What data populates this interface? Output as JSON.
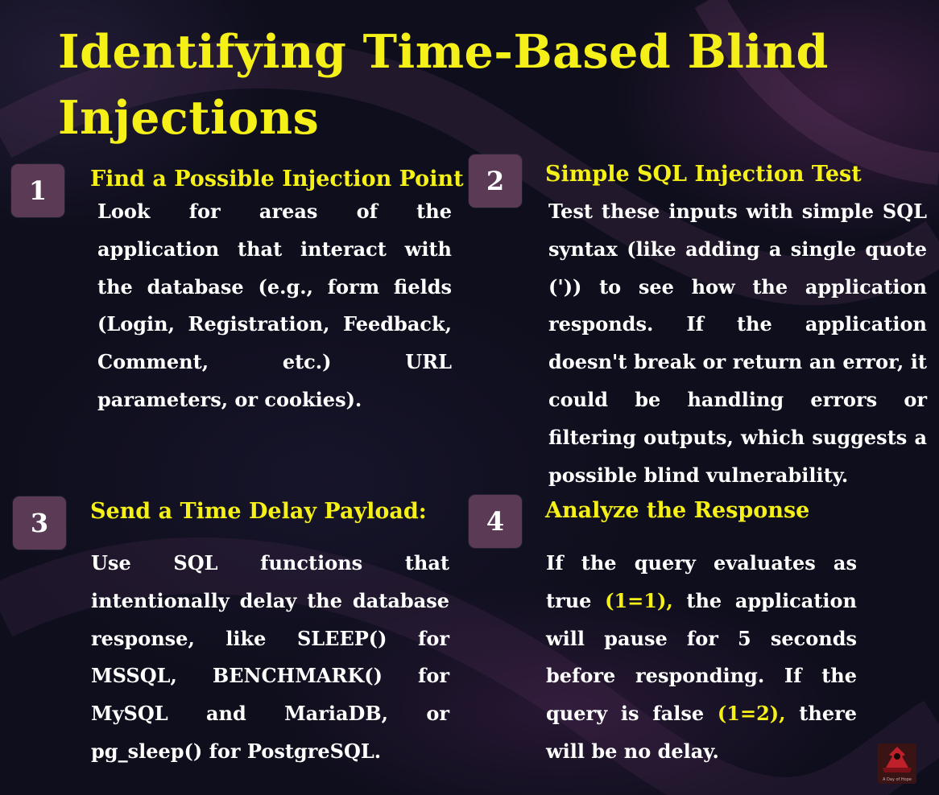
{
  "title": "Identifying Time-Based Blind Injections",
  "steps": [
    {
      "number": "1",
      "heading": "Find a Possible Injection Point",
      "body": "Look for areas of the application that interact with the database (e.g., form fields (Login, Registration, Feedback, Comment, etc.) URL parameters, or cookies)."
    },
    {
      "number": "2",
      "heading": "Simple SQL Injection Test",
      "body": "Test these inputs with simple SQL syntax (like adding a single quote (')) to see how the application responds. If the application doesn't break or return an error, it could be handling errors or filtering outputs, which suggests a possible blind vulnerability."
    },
    {
      "number": "3",
      "heading": "Send a Time Delay Payload:",
      "body": "Use SQL functions that intentionally delay the database response, like SLEEP() for MSSQL, BENCHMARK() for MySQL and MariaDB, or pg_sleep() for PostgreSQL."
    },
    {
      "number": "4",
      "heading": "Analyze the Response",
      "body_parts": [
        "If the query evaluates as true ",
        "(1=1),",
        " the application will pause for 5 seconds before responding. If the query is false ",
        "(1=2),",
        " there will be no delay."
      ]
    }
  ],
  "colors": {
    "title": "#f5f018",
    "heading": "#f5f018",
    "highlight": "#f5f018",
    "body": "#ffffff",
    "number_box": "#5a3a54",
    "background": "#0e0e1c"
  },
  "logo": {
    "icon": "hooded-figure-icon",
    "text": "A Day of Hope"
  }
}
